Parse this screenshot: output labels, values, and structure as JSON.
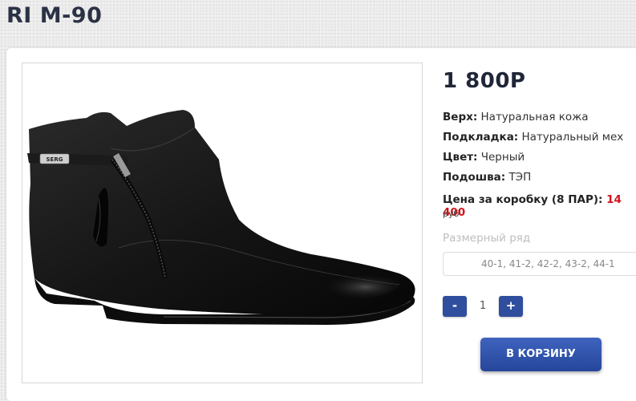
{
  "title": "RI M-90",
  "product": {
    "image_alt": "black leather ankle boot",
    "price": "1 800Р",
    "specs": [
      {
        "label": "Верх:",
        "value": "Натуральная кожа"
      },
      {
        "label": "Подкладка:",
        "value": "Натуральный мех"
      },
      {
        "label": "Цвет:",
        "value": "Черный"
      },
      {
        "label": "Подошва:",
        "value": "ТЭП"
      }
    ],
    "box_price_label": "Цена за коробку (8 ПАР):",
    "box_price_value": "14 400",
    "currency": "руб",
    "size_label": "Размерный ряд",
    "size_value": "40-1, 41-2, 42-2, 43-2, 44-1",
    "qty_minus": "-",
    "qty": "1",
    "qty_plus": "+",
    "cart_button": "В КОРЗИНУ",
    "strap_text": "SERG"
  },
  "colors": {
    "accent": "#2f4e9e",
    "price_highlight": "#d0141c",
    "title": "#2b3245"
  }
}
